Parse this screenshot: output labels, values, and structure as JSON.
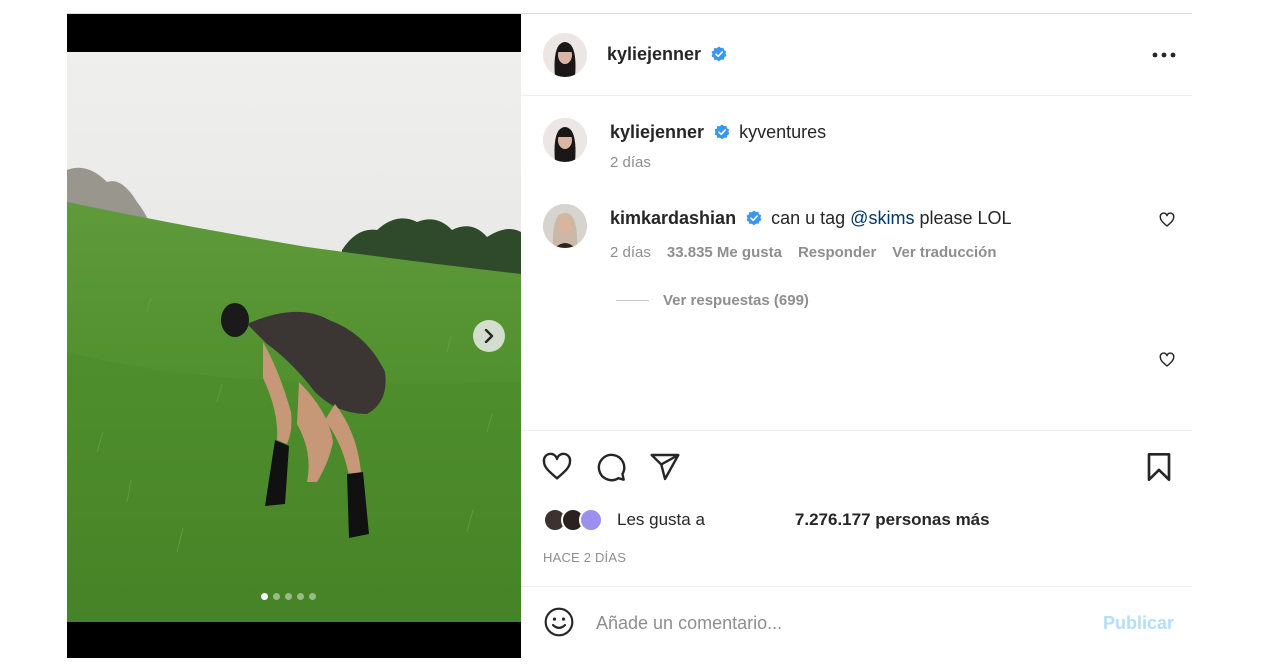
{
  "post": {
    "author": {
      "username": "kyliejenner",
      "verified": true
    },
    "media": {
      "carousel_dots": 5,
      "active_dot": 0,
      "next_icon": "chevron-right-icon"
    },
    "caption": {
      "username": "kyliejenner",
      "text": "kyventures",
      "time": "2 días"
    },
    "comments": [
      {
        "username": "kimkardashian",
        "verified": true,
        "text_before": "can u tag",
        "mention": "@skims",
        "text_after": "please LOL",
        "time": "2 días",
        "likes": "33.835 Me gusta",
        "reply_label": "Responder",
        "translate_label": "Ver traducción",
        "view_replies": "Ver respuestas (699)"
      }
    ],
    "likes": {
      "prefix": "Les gusta a",
      "count": "7.276.177 personas más"
    },
    "timestamp": "HACE 2 DÍAS",
    "comment_box": {
      "placeholder": "Añade un comentario...",
      "publish": "Publicar"
    }
  },
  "colors": {
    "verified": "#3897f0",
    "mention": "#00376b",
    "publish_disabled": "#b2dffc",
    "meta": "#8e8e8e"
  }
}
